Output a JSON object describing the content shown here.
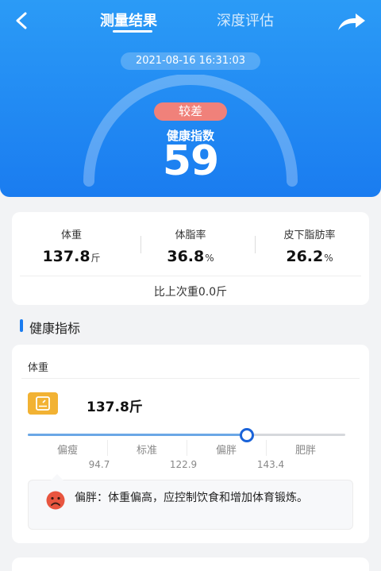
{
  "header": {
    "tabs": [
      "测量结果",
      "深度评估"
    ],
    "datetime": "2021-08-16 16:31:03",
    "grade": "较差",
    "index_label": "健康指数",
    "index_value": "59"
  },
  "stats": [
    {
      "label": "体重",
      "value": "137.8",
      "unit": "斤"
    },
    {
      "label": "体脂率",
      "value": "36.8",
      "unit": "%"
    },
    {
      "label": "皮下脂肪率",
      "value": "26.2",
      "unit": "%"
    }
  ],
  "compare_text": "比上次重0.0斤",
  "section_title": "健康指标",
  "weight_card": {
    "title": "体重",
    "value": "137.8斤",
    "segments": [
      "偏瘦",
      "标准",
      "偏胖",
      "肥胖"
    ],
    "thresholds": [
      "94.7",
      "122.9",
      "143.4"
    ],
    "indicator_fraction": 0.69,
    "tip": "偏胖：体重偏高，应控制饮食和增加体育锻炼。"
  },
  "colors": {
    "primary": "#1a7cf0",
    "grade_badge": "#f0817a",
    "scale_icon": "#f2b233",
    "face_icon": "#e8553f"
  },
  "icons": {
    "back": "chevron-left-icon",
    "share": "share-arrow-icon",
    "scale": "scale-icon",
    "face": "sad-face-icon"
  }
}
